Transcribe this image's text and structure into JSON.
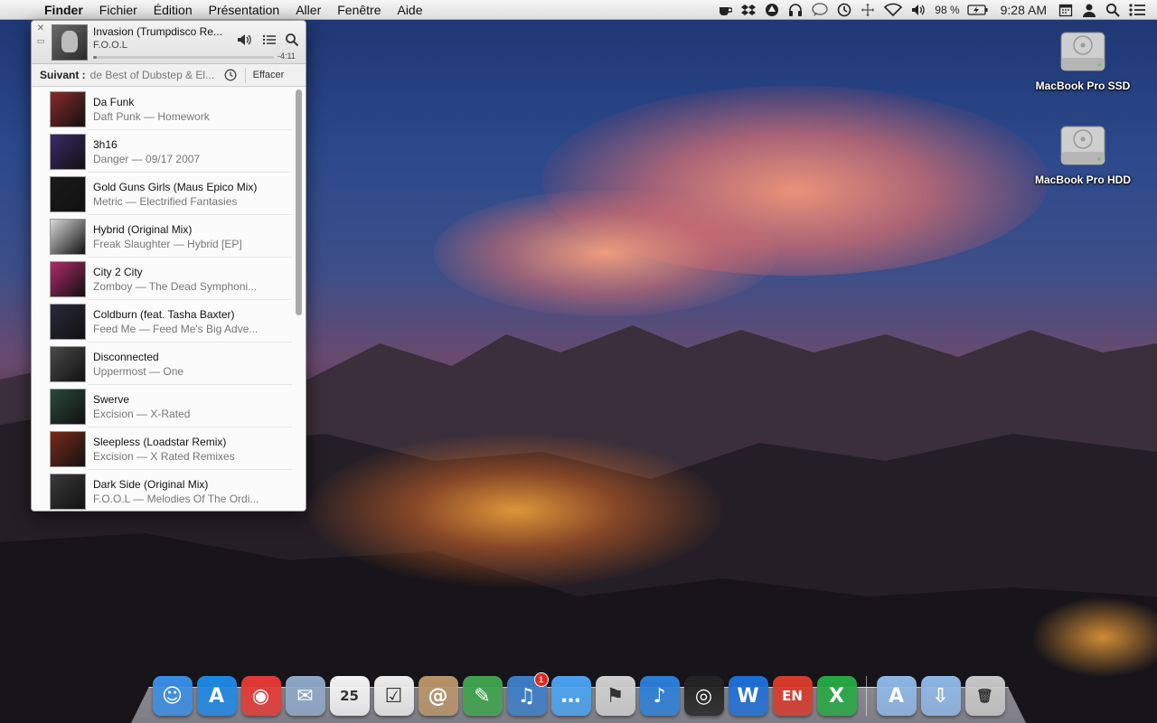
{
  "menubar": {
    "apple_icon": "apple-icon",
    "app_name": "Finder",
    "menus": [
      "Fichier",
      "Édition",
      "Présentation",
      "Aller",
      "Fenêtre",
      "Aide"
    ],
    "status_icons": [
      "coffee-cup-icon",
      "dropbox-icon",
      "google-drive-icon",
      "headphones-icon",
      "speech-bubble-icon",
      "time-machine-icon",
      "move-arrows-icon",
      "wifi-icon",
      "volume-icon"
    ],
    "battery_percent": "98 %",
    "clock": "9:28 AM",
    "right_icons": [
      "calendar-icon",
      "user-icon",
      "spotlight-search-icon",
      "notification-center-icon"
    ]
  },
  "desktop": {
    "icons": [
      {
        "label": "MacBook Pro SSD",
        "icon": "hard-drive-icon"
      },
      {
        "label": "MacBook Pro HDD",
        "icon": "hard-drive-icon"
      }
    ]
  },
  "player": {
    "now_playing": {
      "title": "Invasion (Trumpdisco Re...",
      "artist": "F.O.O.L",
      "remaining": "-4:11",
      "progress": 0.02
    },
    "up_next": {
      "label": "Suivant :",
      "source": "de Best of Dubstep & El...",
      "clear": "Effacer"
    },
    "tracks": [
      {
        "title": "Da Funk",
        "subtitle": "Daft Punk — Homework",
        "art_color": "#8a2a2a"
      },
      {
        "title": "3h16",
        "subtitle": "Danger — 09/17 2007",
        "art_color": "#3a2a6a"
      },
      {
        "title": "Gold Guns Girls (Maus Epico Mix)",
        "subtitle": "Metric — Electrified Fantasies",
        "art_color": "#1a1a1a"
      },
      {
        "title": "Hybrid (Original Mix)",
        "subtitle": "Freak Slaughter — Hybrid [EP]",
        "art_color": "#d8d8d8"
      },
      {
        "title": "City 2 City",
        "subtitle": "Zomboy — The Dead Symphoni...",
        "art_color": "#b02a6a"
      },
      {
        "title": "Coldburn (feat. Tasha Baxter)",
        "subtitle": "Feed Me — Feed Me's Big Adve...",
        "art_color": "#2a2a3a"
      },
      {
        "title": "Disconnected",
        "subtitle": "Uppermost — One",
        "art_color": "#4a4a4a"
      },
      {
        "title": "Swerve",
        "subtitle": "Excision — X-Rated",
        "art_color": "#2a4a3a"
      },
      {
        "title": "Sleepless (Loadstar Remix)",
        "subtitle": "Excision — X Rated Remixes",
        "art_color": "#7a2a1a"
      },
      {
        "title": "Dark Side (Original Mix)",
        "subtitle": "F.O.O.L — Melodies Of The Ordi...",
        "art_color": "#3a3a3a"
      }
    ]
  },
  "dock": {
    "apps": [
      {
        "name": "finder-icon",
        "color": "#3a8ee6",
        "glyph": "☺"
      },
      {
        "name": "app-store-icon",
        "color": "#1e88e5",
        "glyph": "A"
      },
      {
        "name": "chrome-icon",
        "color": "#e53935",
        "glyph": "◉"
      },
      {
        "name": "mail-icon",
        "color": "#8fa8c8",
        "glyph": "✉"
      },
      {
        "name": "calendar-icon",
        "color": "#f5f5f5",
        "glyph": "25"
      },
      {
        "name": "reminders-icon",
        "color": "#eeeeee",
        "glyph": "☑"
      },
      {
        "name": "contacts-icon",
        "color": "#b8956a",
        "glyph": "@"
      },
      {
        "name": "evernote-icon",
        "color": "#3fa34d",
        "glyph": "✎"
      },
      {
        "name": "tweetbot-icon",
        "color": "#3d7ec8",
        "glyph": "♫",
        "badge": "1"
      },
      {
        "name": "messages-icon",
        "color": "#4aa3f0",
        "glyph": "…"
      },
      {
        "name": "transmit-icon",
        "color": "#d0d0d0",
        "glyph": "⚑"
      },
      {
        "name": "itunes-icon",
        "color": "#2c7fd9",
        "glyph": "♪"
      },
      {
        "name": "camera-lens-icon",
        "color": "#222222",
        "glyph": "◎"
      },
      {
        "name": "word-icon",
        "color": "#1e6fd9",
        "glyph": "W"
      },
      {
        "name": "language-en-icon",
        "color": "#d83a2a",
        "glyph": "EN"
      },
      {
        "name": "excel-icon",
        "color": "#27a844",
        "glyph": "X"
      }
    ],
    "stacks": [
      {
        "name": "applications-folder-icon",
        "color": "#8fb8e6",
        "glyph": "A"
      },
      {
        "name": "downloads-folder-icon",
        "color": "#8fb8e6",
        "glyph": "⇩"
      },
      {
        "name": "trash-icon",
        "color": "#c8c8c8",
        "glyph": "🗑"
      }
    ]
  }
}
